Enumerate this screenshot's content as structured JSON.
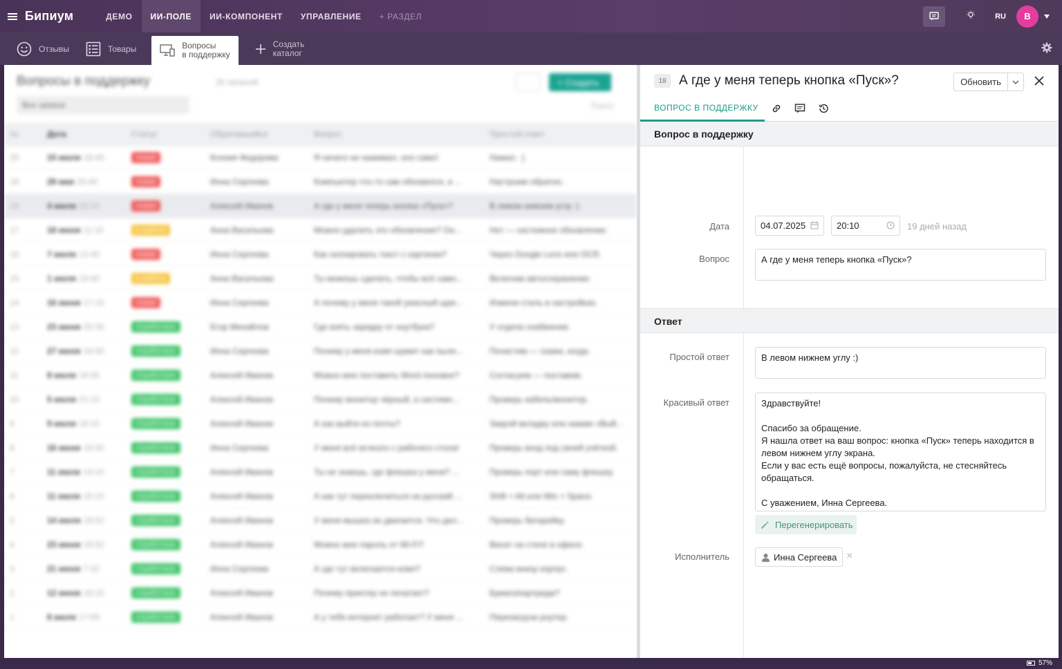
{
  "app": {
    "brand": "Бипиум",
    "nav": [
      {
        "label": "ДЕМО",
        "active": false
      },
      {
        "label": "ИИ-ПОЛЕ",
        "active": true
      },
      {
        "label": "ИИ-КОМПОНЕНТ",
        "active": false
      },
      {
        "label": "УПРАВЛЕНИЕ",
        "active": false
      },
      {
        "label": "+ РАЗДЕЛ",
        "active": false
      }
    ],
    "lang": "RU",
    "avatar_letter": "В"
  },
  "subtabs": [
    {
      "label": "Отзывы"
    },
    {
      "label": "Товары"
    },
    {
      "label_line1": "Вопросы",
      "label_line2": "в поддержку"
    },
    {
      "label_line1": "Создать",
      "label_line2": "каталог"
    }
  ],
  "list": {
    "title": "Вопросы в поддержку",
    "count": "20 записей",
    "filter": "Все записи",
    "create": "+ Создать",
    "search": "Поиск",
    "columns": [
      "№",
      "Дата",
      "Статус",
      "Обратившийся",
      "Вопрос",
      "Простой ответ"
    ],
    "rows": [
      {
        "num": "20",
        "date": "10 июля",
        "time": "18:45",
        "status": "новая",
        "user": "Ксения Федорова",
        "q": "Я ничего не нажимал, оно само!",
        "a": "Нажал. :)"
      },
      {
        "num": "19",
        "date": "28 мая",
        "time": "20:40",
        "status": "новая",
        "user": "Инна Сергеева",
        "q": "Компьютер что-то сам обновился, и ...",
        "a": "Настроим обратно."
      },
      {
        "num": "18",
        "date": "4 июля",
        "time": "20:10",
        "status": "новая",
        "user": "Алексей Иванов",
        "q": "А где у меня теперь кнопка «Пуск»?",
        "a": "В левом нижнем углу :)"
      },
      {
        "num": "17",
        "date": "18 июня",
        "time": "11:15",
        "status": "в работе",
        "user": "Анна Васильева",
        "q": "Можно удалить это обновление? Он...",
        "a": "Нет — системное обновление."
      },
      {
        "num": "16",
        "date": "7 июля",
        "time": "13:40",
        "status": "новая",
        "user": "Инна Сергеева",
        "q": "Как скопировать текст с картинки?",
        "a": "Через Google Lens или OCR."
      },
      {
        "num": "15",
        "date": "1 июля",
        "time": "18:40",
        "status": "в работе",
        "user": "Анна Васильева",
        "q": "Ты можешь сделать, чтобы всё само...",
        "a": "Включим автосохранение."
      },
      {
        "num": "14",
        "date": "16 июня",
        "time": "17:15",
        "status": "новая",
        "user": "Инна Сергеева",
        "q": "А почему у меня такой ужасный шри...",
        "a": "Измени стиль в настройках."
      },
      {
        "num": "13",
        "date": "23 июня",
        "time": "20:35",
        "status": "отработано",
        "user": "Егор Михайлов",
        "q": "Где взять зарядку от ноутбука?",
        "a": "У отдела снабжения."
      },
      {
        "num": "12",
        "date": "27 июня",
        "time": "16:50",
        "status": "отработано",
        "user": "Инна Сергеева",
        "q": "Почему у меня комп шумит как пыле...",
        "a": "Почистим — скажи, когда."
      },
      {
        "num": "11",
        "date": "8 июля",
        "time": "16:55",
        "status": "отработано",
        "user": "Алексей Иванов",
        "q": "Можно мне поставить Word поновее?",
        "a": "Согласуем — поставим."
      },
      {
        "num": "10",
        "date": "5 июля",
        "time": "21:10",
        "status": "отработано",
        "user": "Алексей Иванов",
        "q": "Почему монитор чёрный, а системн...",
        "a": "Проверь кабель/монитор."
      },
      {
        "num": "9",
        "date": "9 июля",
        "time": "18:15",
        "status": "отработано",
        "user": "Алексей Иванов",
        "q": "А как выйти из почты?",
        "a": "Закрой вкладку или нажми «Вый..."
      },
      {
        "num": "8",
        "date": "16 июня",
        "time": "15:00",
        "status": "отработано",
        "user": "Инна Сергеева",
        "q": "У меня всё исчезло с рабочего стола!",
        "a": "Проверь вход под своей учёткой."
      },
      {
        "num": "7",
        "date": "11 июля",
        "time": "14:10",
        "status": "отработано",
        "user": "Алексей Иванов",
        "q": "Ты не знаешь, где флешка у меня? ...",
        "a": "Проверь порт или саму флешку."
      },
      {
        "num": "6",
        "date": "11 июля",
        "time": "16:10",
        "status": "отработано",
        "user": "Алексей Иванов",
        "q": "А как тут переключиться на русский ...",
        "a": "Shift + Alt или Win + Space."
      },
      {
        "num": "5",
        "date": "14 июля",
        "time": "18:52",
        "status": "отработано",
        "user": "Алексей Иванов",
        "q": "У меня мышка не двигается. Что дел...",
        "a": "Проверь батарейку."
      },
      {
        "num": "4",
        "date": "23 июня",
        "time": "16:52",
        "status": "отработано",
        "user": "Алексей Иванов",
        "q": "Можно мне пароль от Wi-Fi?",
        "a": "Висит на стене в офисе."
      },
      {
        "num": "3",
        "date": "21 июня",
        "time": "7:32",
        "status": "отработано",
        "user": "Инна Сергеева",
        "q": "А где тут включается комп?",
        "a": "Слева внизу корпус."
      },
      {
        "num": "2",
        "date": "12 июня",
        "time": "18:15",
        "status": "отработано",
        "user": "Алексей Иванов",
        "q": "Почему принтер не печатает?",
        "a": "Бумага/картридж?"
      },
      {
        "num": "1",
        "date": "8 июля",
        "time": "17:05",
        "status": "отработано",
        "user": "Алексей Иванов",
        "q": "А у тебя интернет работает? У меня ...",
        "a": "Перезагрузи роутер."
      }
    ]
  },
  "record": {
    "id": "18",
    "title": "А где у меня теперь кнопка «Пуск»?",
    "update": "Обновить",
    "tab": "ВОПРОС В ПОДДЕРЖКУ",
    "section1": "Вопрос в поддержку",
    "date_label": "Дата",
    "date": "04.07.2025",
    "time": "20:10",
    "ago": "19 дней назад",
    "question_label": "Вопрос",
    "question": "А где у меня теперь кнопка «Пуск»?",
    "section2": "Ответ",
    "simple_label": "Простой ответ",
    "simple": "В левом нижнем углу :)",
    "pretty_label": "Красивый ответ",
    "pretty_lines": [
      "Здравствуйте!",
      "",
      "Спасибо за обращение.",
      "Я нашла ответ на ваш вопрос: кнопка «Пуск» теперь находится в",
      "левом нижнем углу экрана.",
      "Если у вас есть ещё вопросы, пожалуйста, не стесняйтесь",
      "обращаться.",
      "",
      "С уважением, Инна Сергеева."
    ],
    "regen": "Перегенерировать",
    "executor_label": "Исполнитель",
    "executor": "Инна Сергеева"
  },
  "battery": "57%",
  "colors": {
    "accent": "#1b9c8b",
    "new": "#f05a5a",
    "inwork": "#f5c542",
    "done": "#3fc46a"
  },
  "icons": [
    "menu-icon",
    "chat-icon",
    "bulb-icon",
    "smile-icon",
    "list-icon",
    "monitor-icon",
    "plus-icon",
    "gear-icon",
    "link-icon",
    "comment-icon",
    "history-icon",
    "close-icon",
    "calendar-icon",
    "clock-icon",
    "wand-icon",
    "user-icon"
  ]
}
